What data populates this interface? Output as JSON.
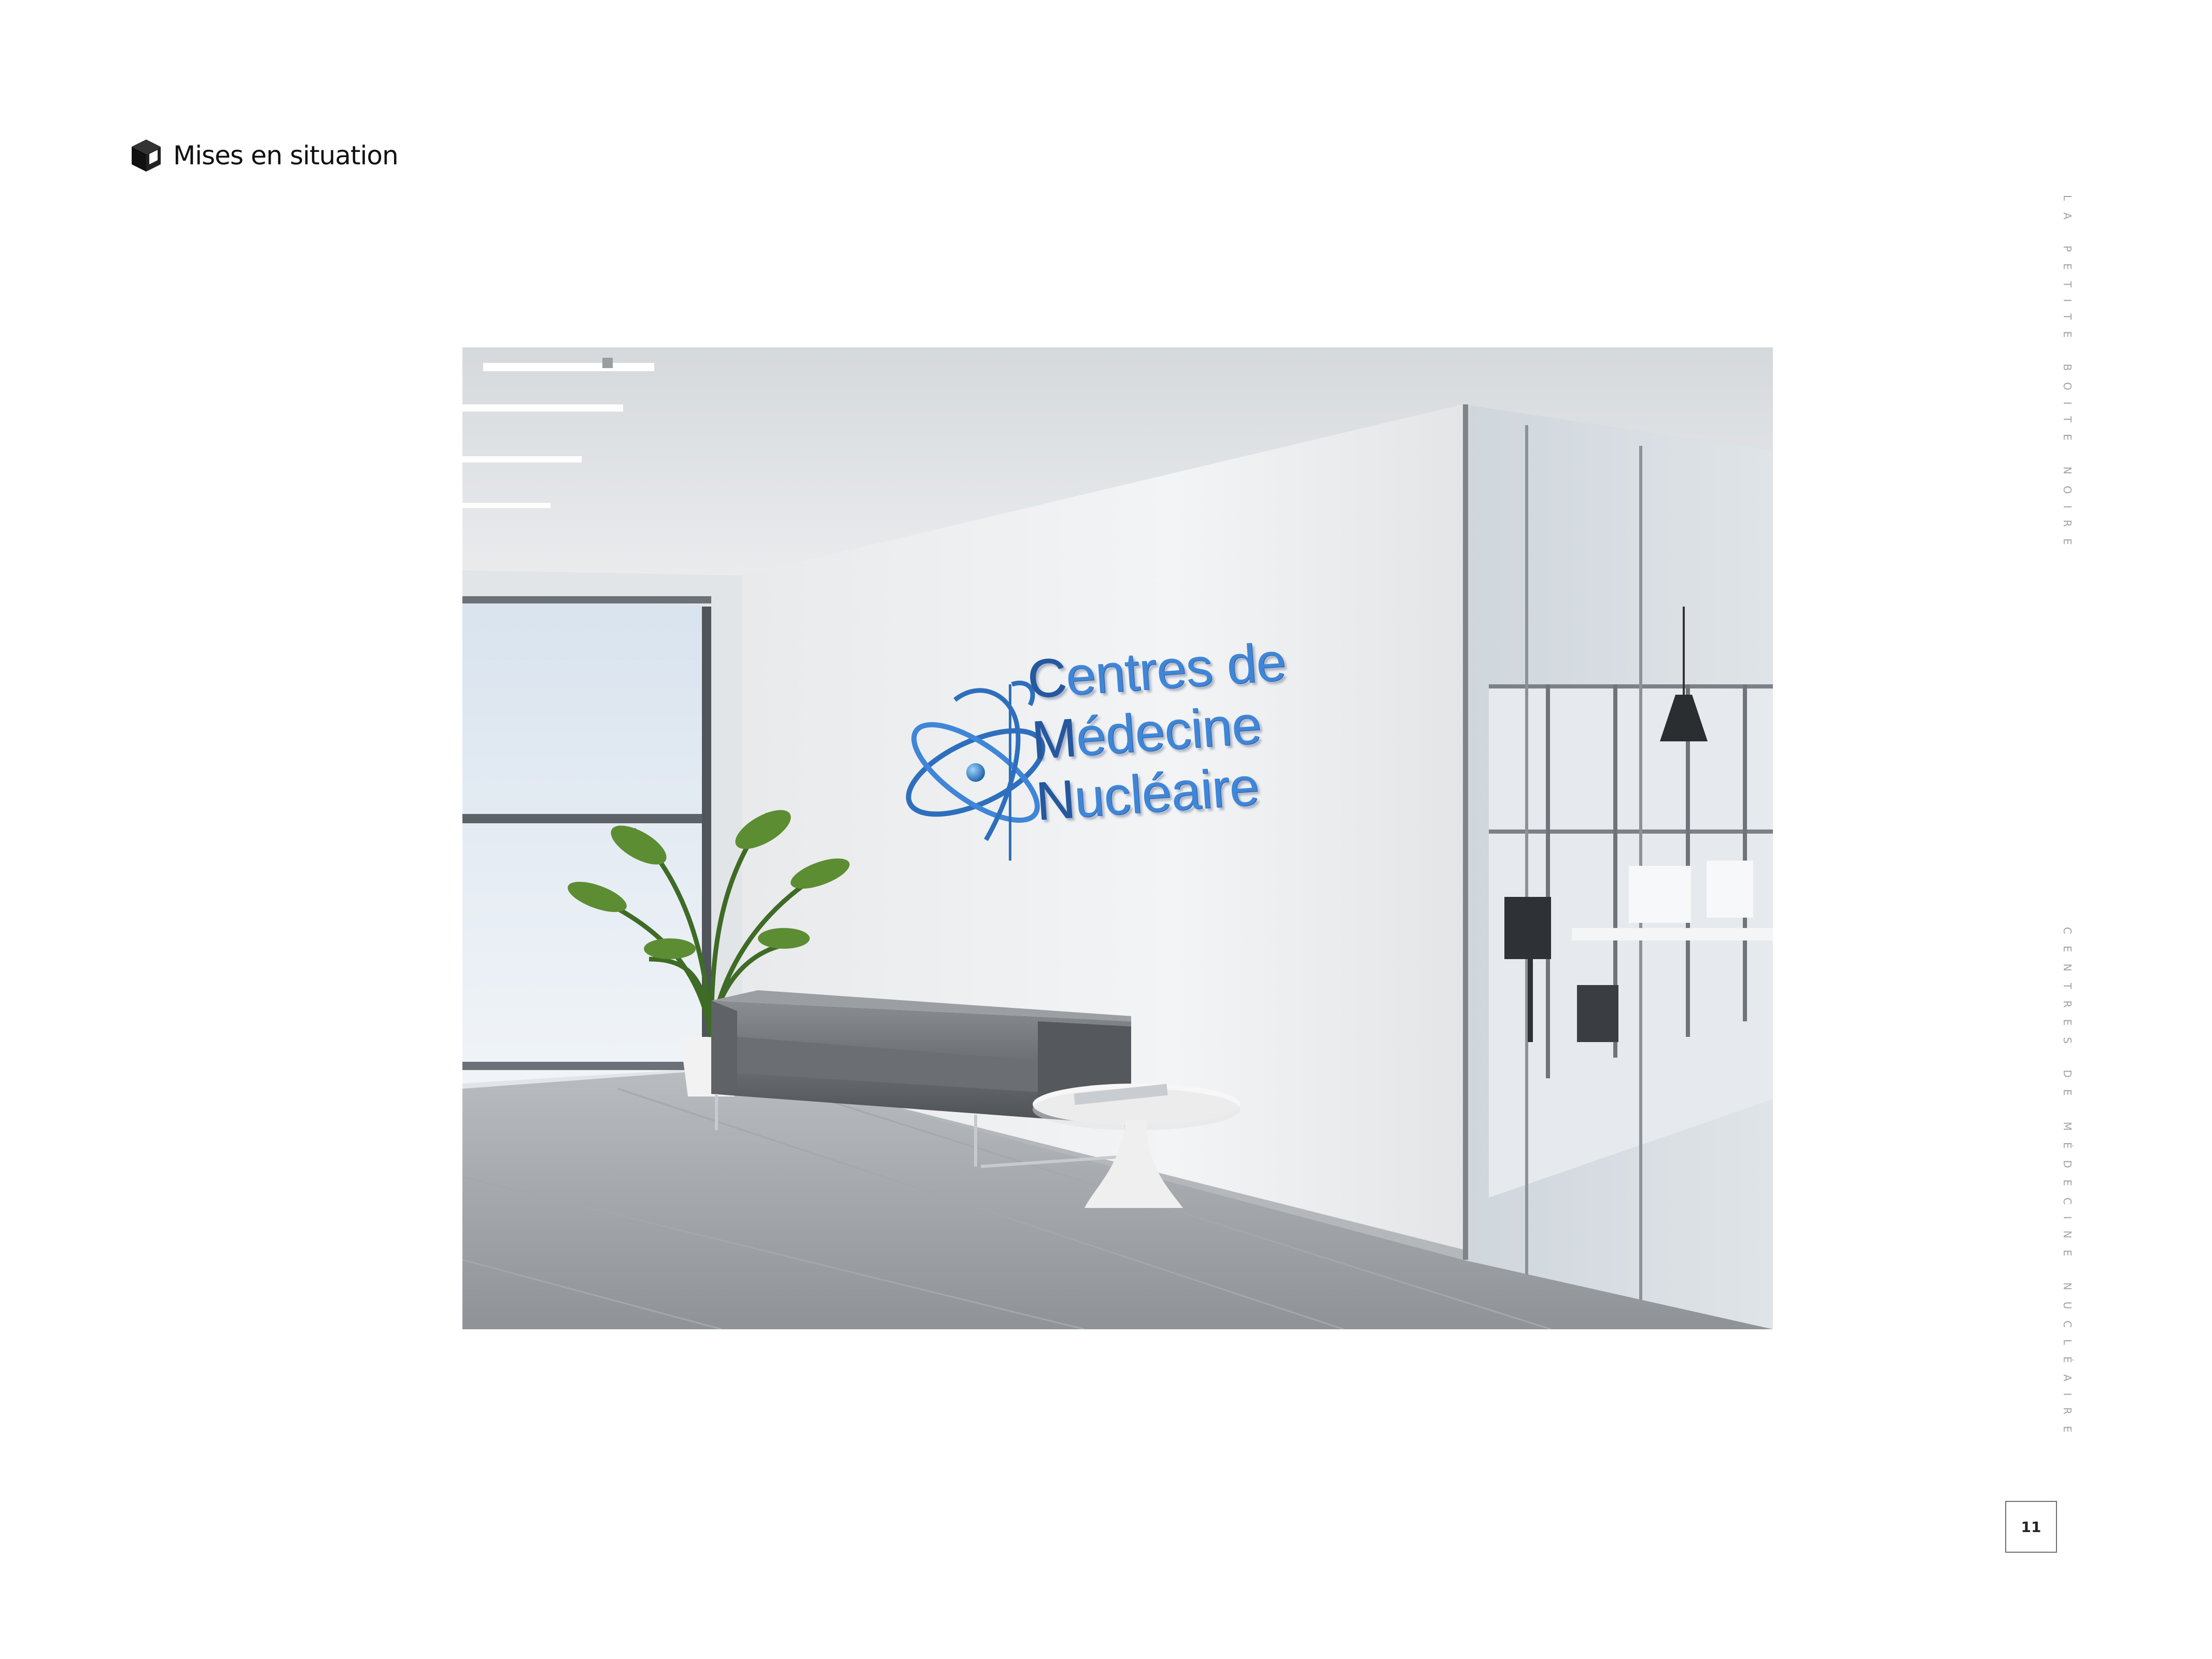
{
  "header": {
    "title": "Mises en situation",
    "icon": "cube-icon"
  },
  "side": {
    "top_text": "LA PETITE BOITE NOIRE",
    "bottom_text": "CENTRES DE MÉDECINE NUCLÉAIRE"
  },
  "page": {
    "number": "11"
  },
  "mockup": {
    "sign": {
      "line1": "Centres de",
      "line2": "Médecine",
      "line3": "Nucléaire",
      "logo": "atom-logo-icon",
      "color": "#3f86d8"
    }
  }
}
